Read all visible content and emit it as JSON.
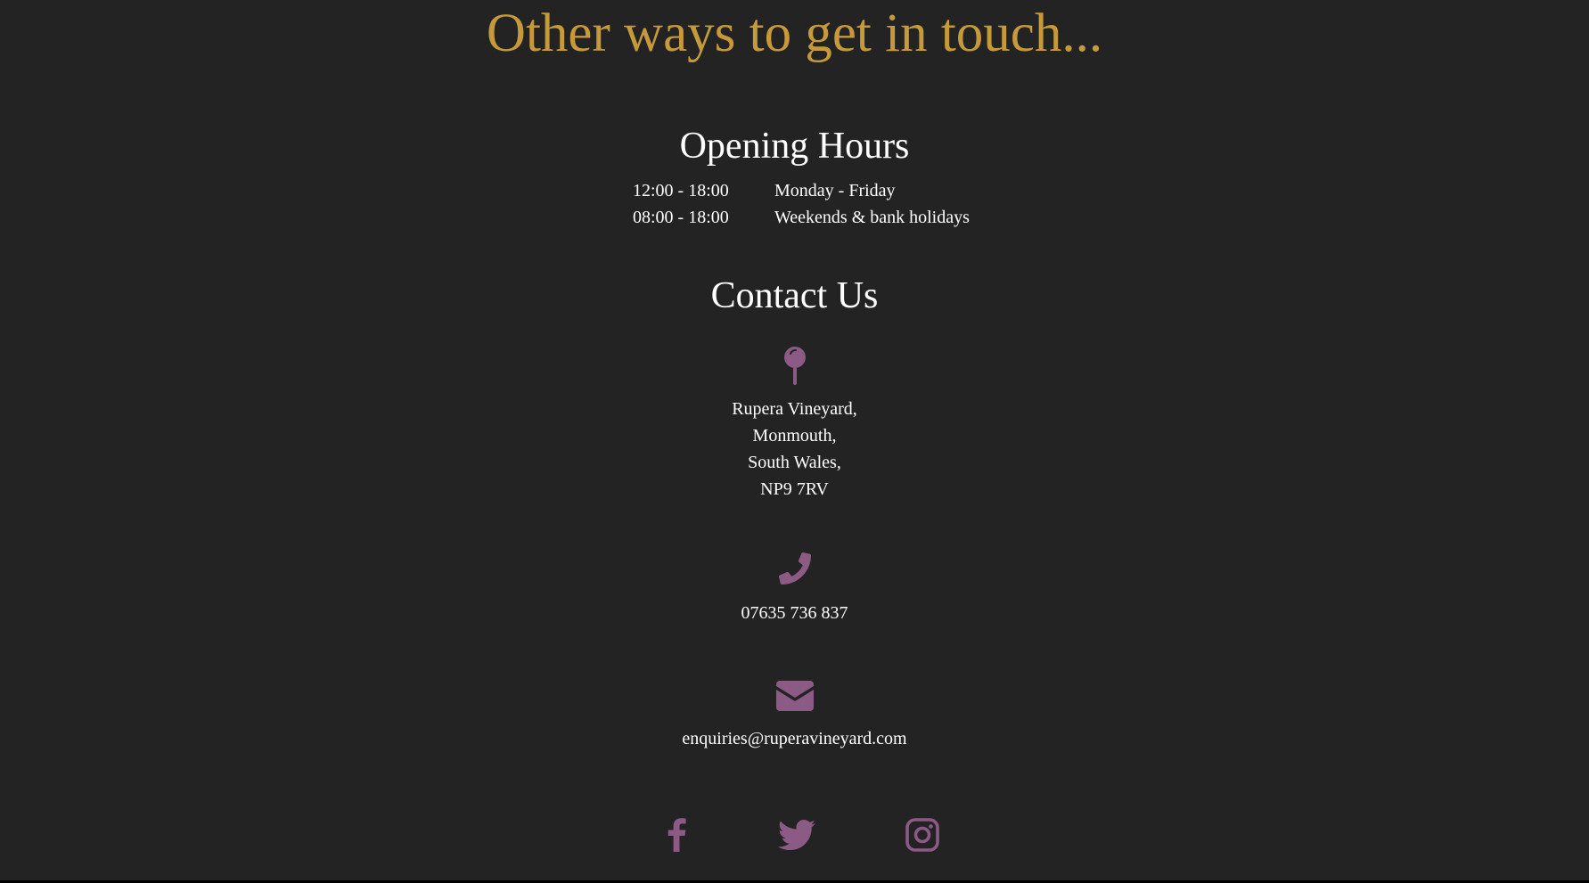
{
  "main_title": "Other ways to get in touch...",
  "opening_hours": {
    "title": "Opening Hours",
    "rows": [
      {
        "time": "12:00 - 18:00",
        "days": "Monday - Friday"
      },
      {
        "time": "08:00 - 18:00",
        "days": "Weekends & bank holidays"
      }
    ]
  },
  "contact": {
    "title": "Contact Us",
    "address_icon": "map-pin-icon",
    "address_lines": [
      "Rupera Vineyard,",
      "Monmouth,",
      "South Wales,",
      "NP9 7RV"
    ],
    "phone_icon": "phone-icon",
    "phone": "07635 736 837",
    "email_icon": "envelope-icon",
    "email": "enquiries@ruperavineyard.com"
  },
  "social": [
    {
      "name": "facebook",
      "icon": "facebook-icon"
    },
    {
      "name": "twitter",
      "icon": "twitter-icon"
    },
    {
      "name": "instagram",
      "icon": "instagram-icon"
    }
  ],
  "colors": {
    "background": "#232323",
    "title_gold": "#c69a3a",
    "icon_purple": "#8b5a85",
    "text": "#ffffff"
  }
}
